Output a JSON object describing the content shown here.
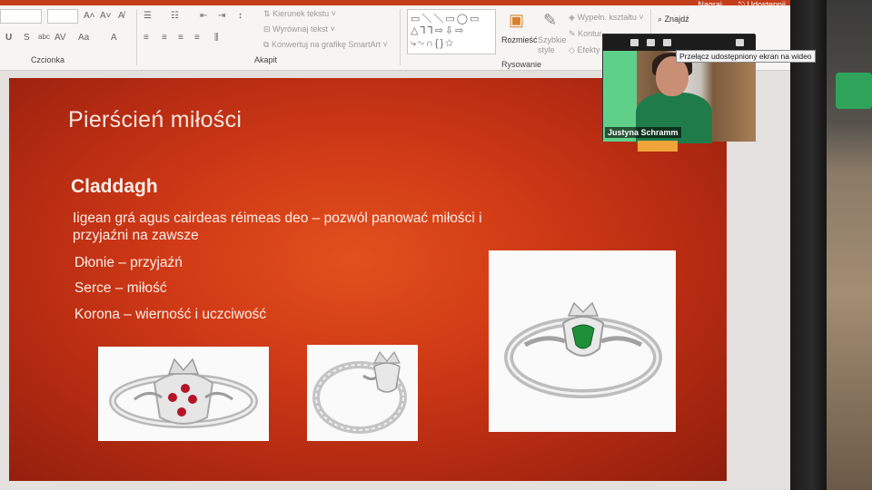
{
  "titlebar": {
    "record_label": "Nagraj",
    "share_label": "Udostępnij"
  },
  "ribbon": {
    "font_group_label": "Czcionka",
    "paragraph_group_label": "Akapit",
    "drawing_group_label": "Rysowanie",
    "text_direction_label": "Kierunek tekstu",
    "align_text_label": "Wyrównaj tekst",
    "smartart_label": "Konwertuj na grafikę SmartArt",
    "arrange_label": "Rozmieść",
    "quick_styles_label": "Szybkie style",
    "shape_fill_label": "Wypełn. kształtu",
    "shape_outline_label": "Kontur",
    "shape_effects_label": "Efekty",
    "find_label": "Znajdź"
  },
  "slide": {
    "title": "Pierścień miłości",
    "heading": "Claddagh",
    "irish_line1": "Iigean grá agus cairdeas réimeas deo – pozwól panować miłości i",
    "irish_line2": "przyjaźni na zawsze",
    "item_hands": "Dłonie – przyjaźń",
    "item_heart": "Serce – miłość",
    "item_crown": "Korona – wierność i uczciwość"
  },
  "video": {
    "participant_name": "Justyna Schramm",
    "tooltip": "Przełącz udostępniony ekran na wideo"
  },
  "colors": {
    "accent": "#c43e1c",
    "slide_red": "#d03a16"
  }
}
